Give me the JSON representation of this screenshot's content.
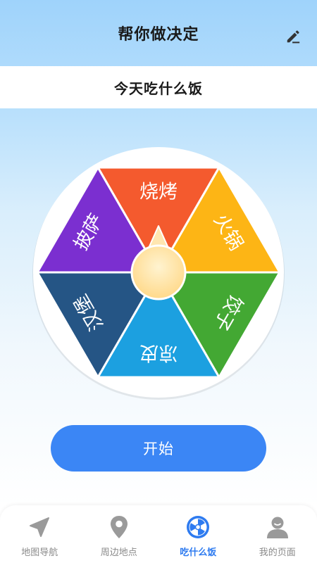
{
  "header": {
    "title": "帮你做决定",
    "edit_icon": "pencil-icon"
  },
  "subtitle": "今天吃什么饭",
  "wheel": {
    "segments": [
      {
        "label": "烧烤",
        "color": "#f45a2e"
      },
      {
        "label": "火锅",
        "color": "#fdb515"
      },
      {
        "label": "饺子",
        "color": "#43a833"
      },
      {
        "label": "凉皮",
        "color": "#1ca0e0"
      },
      {
        "label": "汉堡",
        "color": "#255585"
      },
      {
        "label": "披萨",
        "color": "#7b2fd0"
      }
    ],
    "hub_color": "#ffd98a",
    "pointer_color": "#ffe6b0"
  },
  "start_button": {
    "label": "开始",
    "color": "#3b86f5"
  },
  "tabs": [
    {
      "label": "地图导航",
      "icon": "navigation-arrow-icon",
      "active": false
    },
    {
      "label": "周边地点",
      "icon": "location-pin-icon",
      "active": false
    },
    {
      "label": "吃什么饭",
      "icon": "wheel-icon",
      "active": true
    },
    {
      "label": "我的页面",
      "icon": "user-profile-icon",
      "active": false
    }
  ],
  "colors": {
    "accent": "#2e7bf0",
    "inactive": "#8a8a8a"
  }
}
